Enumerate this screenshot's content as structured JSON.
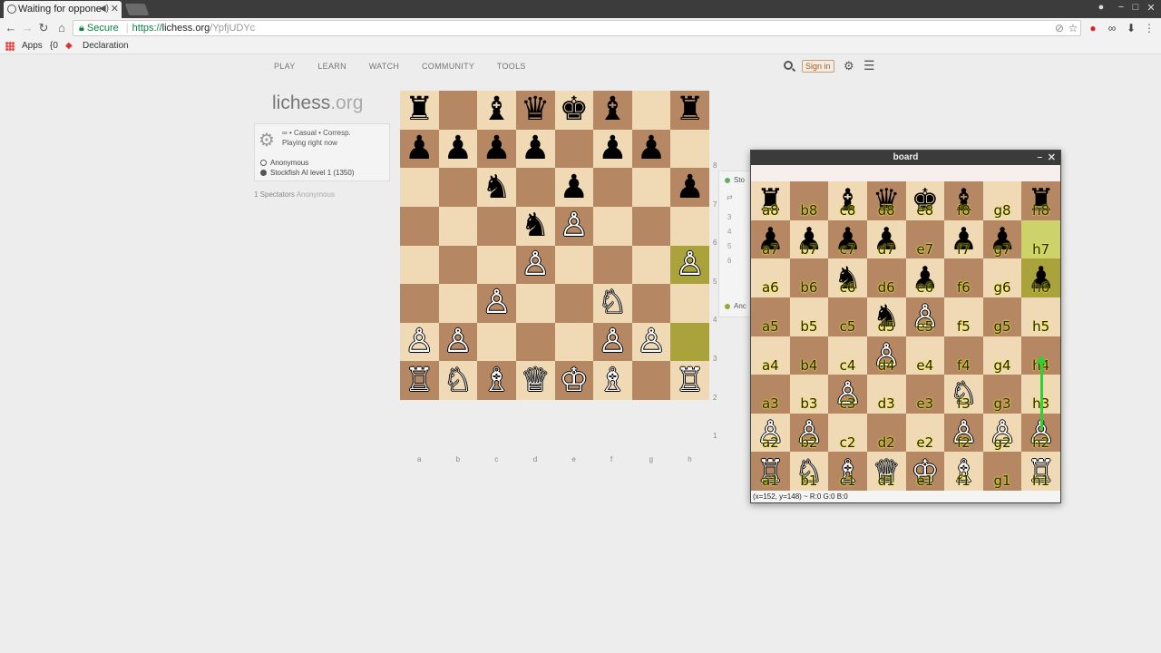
{
  "browser": {
    "tab_title": "Waiting for oppone",
    "url_secure": "Secure",
    "url_scheme": "https://",
    "url_host": "lichess.org",
    "url_path": "/YpfjUDYc",
    "bookmarks": [
      "Apps",
      "{0",
      "Declaration"
    ]
  },
  "nav": {
    "items": [
      "PLAY",
      "LEARN",
      "WATCH",
      "COMMUNITY",
      "TOOLS"
    ],
    "signin": "Sign in"
  },
  "logo": {
    "main": "lichess",
    "tld": ".org"
  },
  "game": {
    "line1": "∞ • Casual • Corresp.",
    "line2": "Playing right now",
    "white_player": "Anonymous",
    "black_player": "Stockfish AI level 1 (1350)",
    "spectators": "1 Spectators",
    "spectator_name": "Anonymous"
  },
  "side_panel": {
    "top": "Sto",
    "moves": [
      "3",
      "4",
      "5",
      "6"
    ],
    "bottom": "Anc"
  },
  "board": {
    "ranks": [
      "8",
      "7",
      "6",
      "5",
      "4",
      "3",
      "2",
      "1"
    ],
    "files": [
      "a",
      "b",
      "c",
      "d",
      "e",
      "f",
      "g",
      "h"
    ],
    "pieces": [
      [
        "♜",
        "",
        "♝",
        "♛",
        "♚",
        "♝",
        "",
        "♜"
      ],
      [
        "♟",
        "♟",
        "♟",
        "♟",
        "",
        "♟",
        "♟",
        ""
      ],
      [
        "",
        "",
        "♞",
        "",
        "♟",
        "",
        "",
        "♟"
      ],
      [
        "",
        "",
        "",
        "♞",
        "♙",
        "",
        "",
        ""
      ],
      [
        "",
        "",
        "",
        "♙",
        "",
        "",
        "",
        "♙"
      ],
      [
        "",
        "",
        "♙",
        "",
        "",
        "♘",
        "",
        ""
      ],
      [
        "♙",
        "♙",
        "",
        "",
        "",
        "♙",
        "♙",
        ""
      ],
      [
        "♖",
        "♘",
        "♗",
        "♕",
        "♔",
        "♗",
        "",
        "♖"
      ]
    ]
  },
  "window": {
    "title": "board",
    "status": "(x=152, y=148) ~ R:0 G:0 B:0",
    "coords": [
      [
        "a8",
        "b8",
        "c8",
        "d8",
        "e8",
        "f8",
        "g8",
        "h8"
      ],
      [
        "a7",
        "b7",
        "c7",
        "d7",
        "e7",
        "f7",
        "g7",
        "h7"
      ],
      [
        "a6",
        "b6",
        "c6",
        "d6",
        "e6",
        "f6",
        "g6",
        "h6"
      ],
      [
        "a5",
        "b5",
        "c5",
        "d5",
        "e5",
        "f5",
        "g5",
        "h5"
      ],
      [
        "a4",
        "b4",
        "c4",
        "d4",
        "e4",
        "f4",
        "g4",
        "h4"
      ],
      [
        "a3",
        "b3",
        "c3",
        "d3",
        "e3",
        "f3",
        "g3",
        "h3"
      ],
      [
        "a2",
        "b2",
        "c2",
        "d2",
        "e2",
        "f2",
        "g2",
        "h2"
      ],
      [
        "a1",
        "b1",
        "c1",
        "d1",
        "e1",
        "f1",
        "g1",
        "h1"
      ]
    ],
    "pieces": [
      [
        "♜",
        "",
        "♝",
        "♛",
        "♚",
        "♝",
        "",
        "♜"
      ],
      [
        "♟",
        "♟",
        "♟",
        "♟",
        "",
        "♟",
        "♟",
        ""
      ],
      [
        "",
        "",
        "♞",
        "",
        "♟",
        "",
        "",
        "♟"
      ],
      [
        "",
        "",
        "",
        "♞",
        "♙",
        "",
        "",
        ""
      ],
      [
        "",
        "",
        "",
        "♙",
        "",
        "",
        "",
        ""
      ],
      [
        "",
        "",
        "♙",
        "",
        "",
        "♘",
        "",
        ""
      ],
      [
        "♙",
        "♙",
        "",
        "",
        "",
        "♙",
        "♙",
        "♙"
      ],
      [
        "♖",
        "♘",
        "♗",
        "♕",
        "♔",
        "♗",
        "",
        "♖"
      ]
    ]
  },
  "colors": {
    "light_square": "#f0d9b5",
    "dark_square": "#b58863",
    "highlight": "#aaa23a",
    "arrow": "#2bd32b"
  }
}
